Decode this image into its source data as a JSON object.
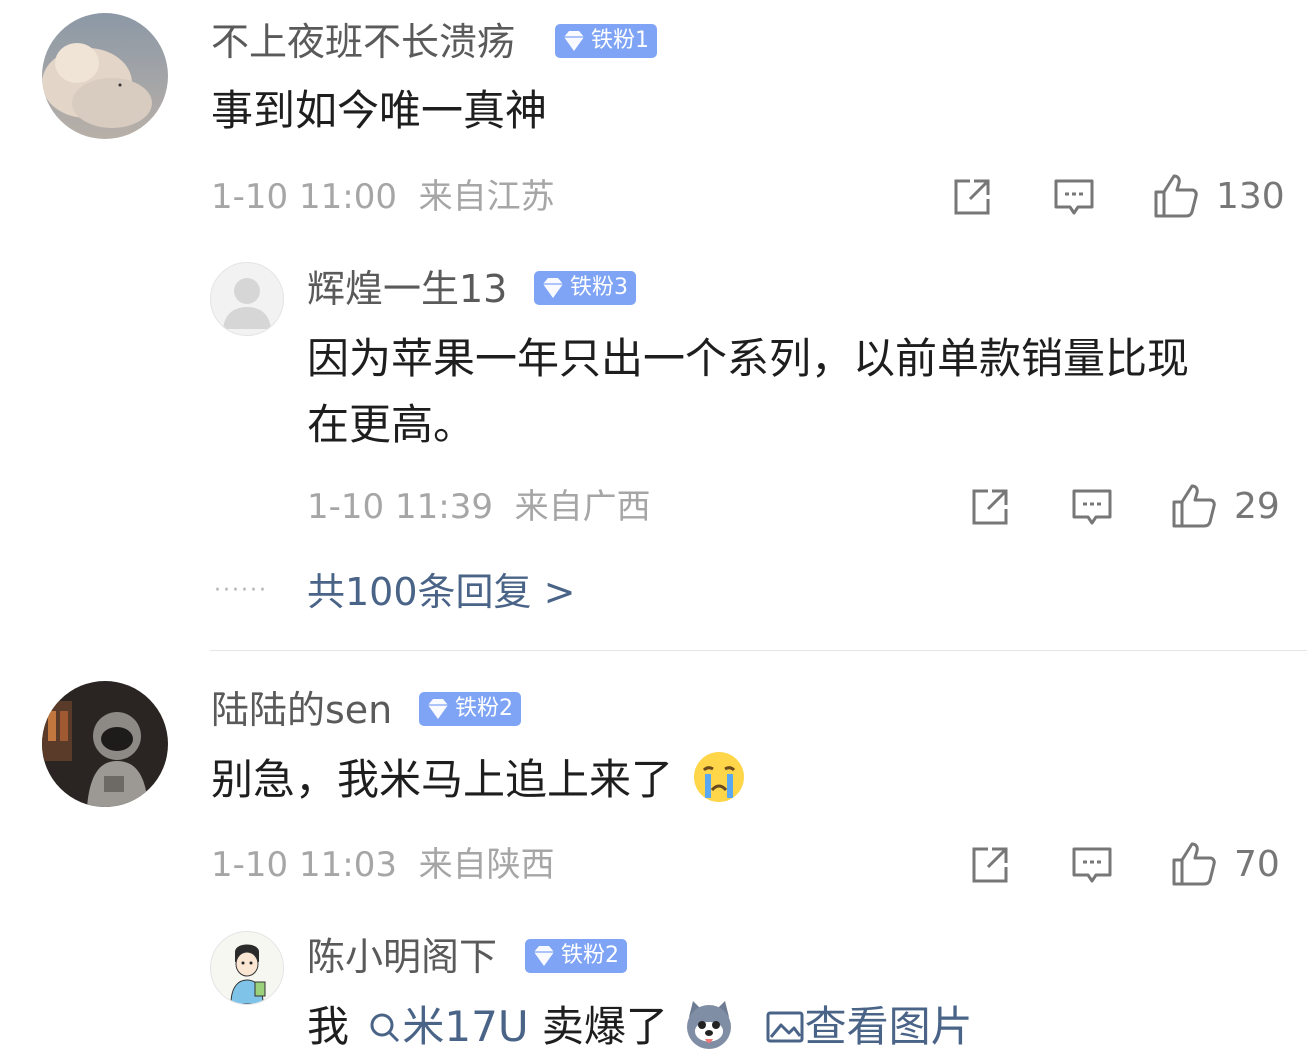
{
  "comments": [
    {
      "username": "不上夜班不长溃疡",
      "badge": "铁粉1",
      "text": "事到如今唯一真神",
      "time": "1-10 11:00",
      "location": "来自江苏",
      "likes": "130"
    },
    {
      "username": "辉煌一生13",
      "badge": "铁粉3",
      "text_line1": "因为苹果一年只出一个系列，以前单款销量比现",
      "text_line2": "在更高。",
      "time": "1-10 11:39",
      "location": "来自广西",
      "likes": "29"
    },
    {
      "username": "陆陆的sen",
      "badge": "铁粉2",
      "text": "别急，我米马上追上来了",
      "time": "1-10 11:03",
      "location": "来自陕西",
      "likes": "70"
    },
    {
      "username": "陈小明阁下",
      "badge": "铁粉2",
      "text_prefix": "我",
      "text_link": "米17U",
      "text_suffix": "卖爆了",
      "view_image": "查看图片"
    }
  ],
  "more_replies": "共100条回复 >",
  "dots": "······",
  "icons": {
    "badge": "diamond-icon",
    "share": "share-icon",
    "comment": "comment-icon",
    "like": "thumbs-up-icon",
    "search": "search-icon",
    "image": "image-icon"
  },
  "colors": {
    "badge_bg": "#7fa4f5",
    "link": "#4a6488",
    "meta": "#a6a6a6"
  }
}
